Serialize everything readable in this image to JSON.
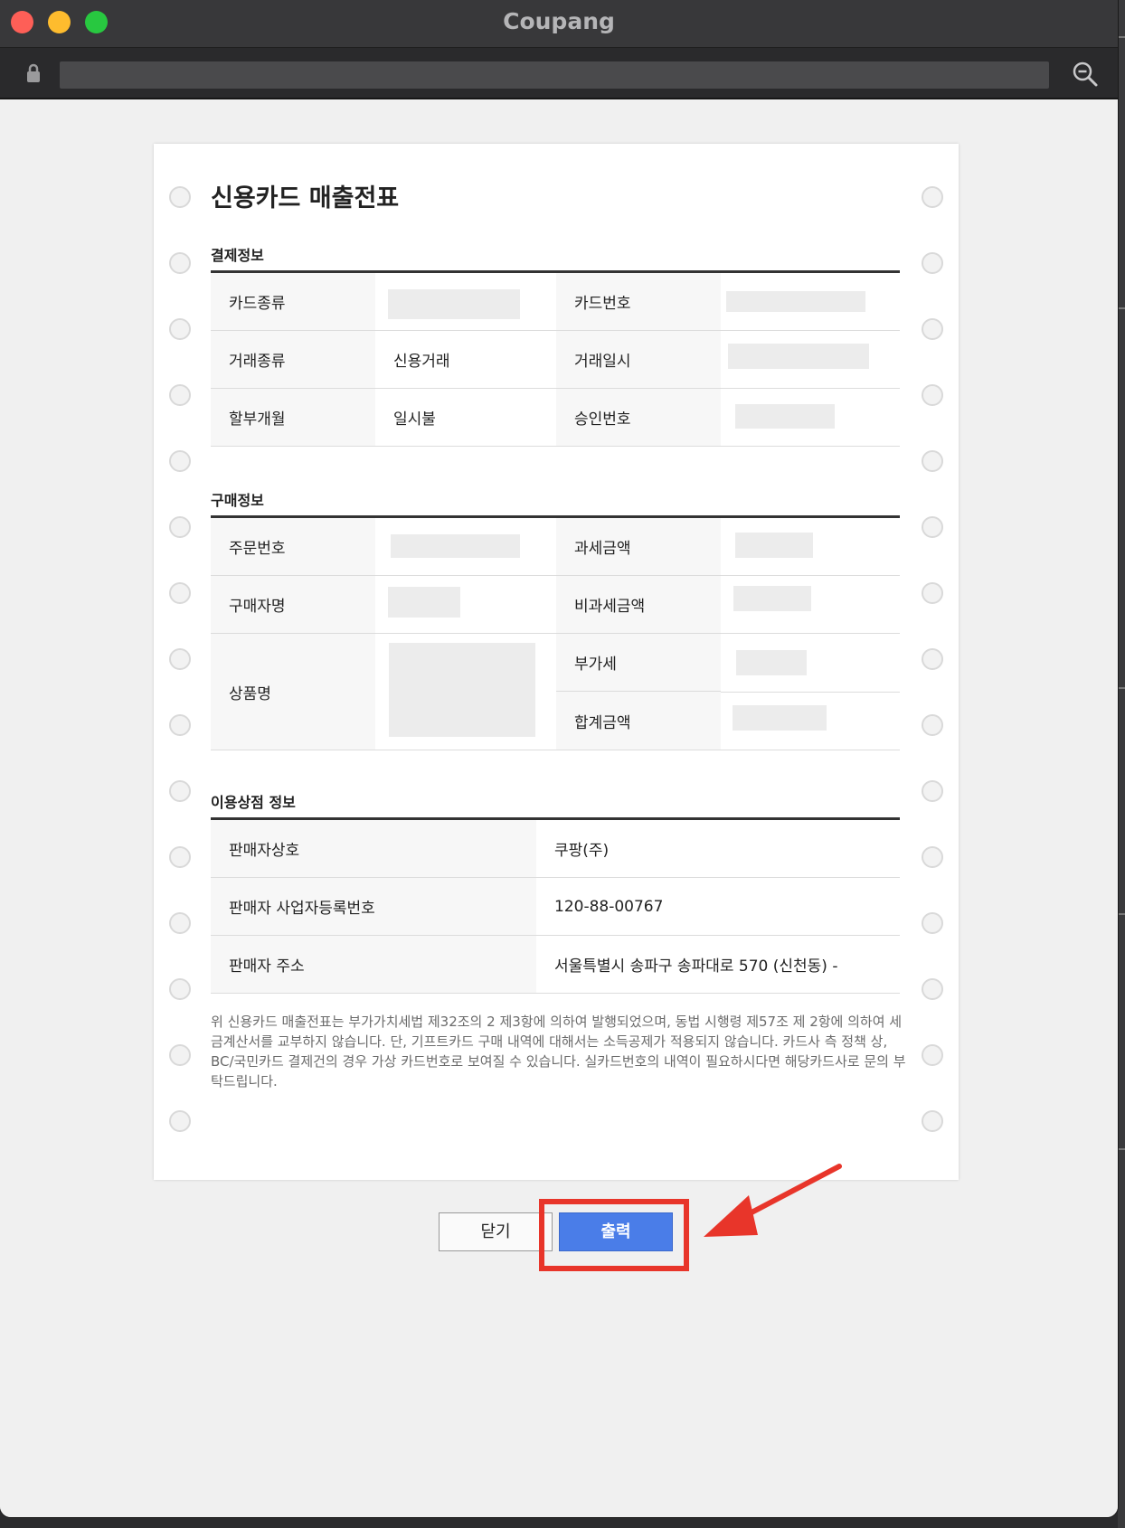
{
  "window": {
    "title": "Coupang",
    "controls": [
      "close",
      "minimize",
      "maximize"
    ]
  },
  "toolbar": {
    "icons": [
      "lock-icon",
      "zoom-out-icon"
    ]
  },
  "receipt": {
    "title": "신용카드 매출전표",
    "payment_section": {
      "title": "결제정보",
      "rows": [
        {
          "label1": "카드종류",
          "value1": "",
          "label2": "카드번호",
          "value2": ""
        },
        {
          "label1": "거래종류",
          "value1": "신용거래",
          "label2": "거래일시",
          "value2": ""
        },
        {
          "label1": "할부개월",
          "value1": "일시불",
          "label2": "승인번호",
          "value2": ""
        }
      ]
    },
    "purchase_section": {
      "title": "구매정보",
      "order_number_label": "주문번호",
      "taxable_amount_label": "과세금액",
      "buyer_name_label": "구매자명",
      "non_taxable_amount_label": "비과세금액",
      "product_name_label": "상품명",
      "vat_label": "부가세",
      "total_amount_label": "합계금액"
    },
    "merchant_section": {
      "title": "이용상점 정보",
      "rows": [
        {
          "label": "판매자상호",
          "value": "쿠팡(주)"
        },
        {
          "label": "판매자 사업자등록번호",
          "value": "120-88-00767"
        },
        {
          "label": "판매자 주소",
          "value": "서울특별시 송파구 송파대로 570 (신천동) -"
        }
      ]
    },
    "notice": "위 신용카드 매출전표는 부가가치세법 제32조의 2 제3항에 의하여 발행되었으며, 동법 시행령 제57조 제 2항에 의하여 세금계산서를 교부하지 않습니다. 단, 기프트카드 구매 내역에 대해서는 소득공제가 적용되지 않습니다. 카드사 측 정책 상, BC/국민카드 결제건의 경우 가상 카드번호로 보여질 수 있습니다. 실카드번호의 내역이 필요하시다면 해당카드사로 문의 부탁드립니다."
  },
  "buttons": {
    "close_label": "닫기",
    "print_label": "출력"
  },
  "annotation": {
    "highlight_color": "#e8352a",
    "target": "print-button"
  },
  "colors": {
    "print_button": "#4a7de8",
    "titlebar": "#38383a"
  }
}
